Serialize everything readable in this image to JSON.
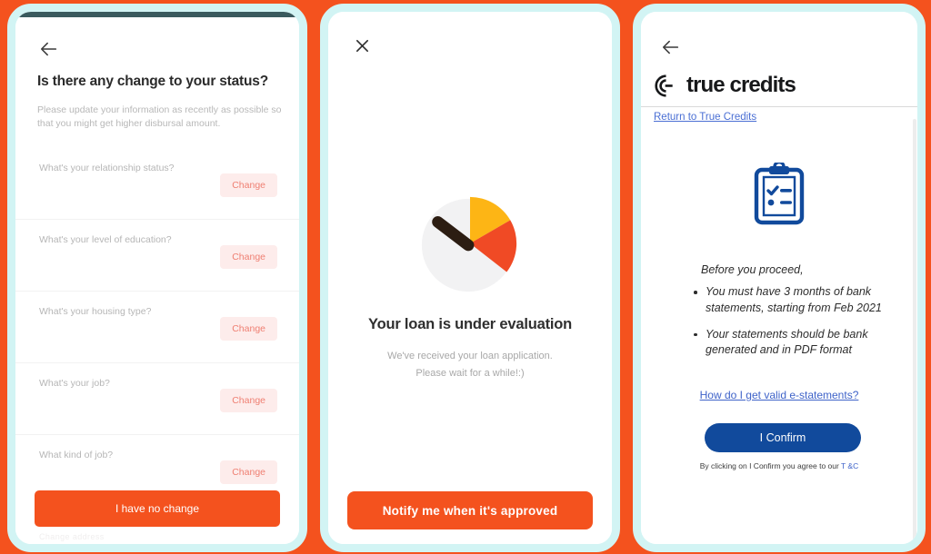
{
  "theme": {
    "background": "#f4521e",
    "panel_border": "#d2f4f4",
    "accent_orange": "#f4521e",
    "accent_blue": "#114a9c",
    "link_blue": "#3f63c9",
    "change_chip_bg": "#fdeceb",
    "change_chip_text": "#ef7f72",
    "muted_text": "#b6b6b6"
  },
  "panel1": {
    "name": "status-update-screen",
    "back_icon": "arrow-left-icon",
    "title": "Is there any change to your status?",
    "subtitle": "Please update your information as recently as possible so that you might get higher disbursal amount.",
    "rows": [
      {
        "label": "What's your relationship status?",
        "button": "Change"
      },
      {
        "label": "What's your level of education?",
        "button": "Change"
      },
      {
        "label": "What's your housing type?",
        "button": "Change"
      },
      {
        "label": "What's your job?",
        "button": "Change"
      },
      {
        "label": "What kind of job?",
        "button": "Change"
      }
    ],
    "cta": "I have no change",
    "cut_off_text": "Change address"
  },
  "panel2": {
    "name": "loan-evaluation-screen",
    "close_icon": "close-x-icon",
    "gauge_icon": "speedometer-gauge-icon",
    "gauge_colors": {
      "dial": "#f2f2f3",
      "yellow": "#fdb515",
      "orange": "#f04a25",
      "needle": "#2c1d12"
    },
    "title": "Your loan is under evaluation",
    "subtitle_line1": "We've received your loan application.",
    "subtitle_line2": "Please wait for a while!:)",
    "cta": "Notify me when it's approved"
  },
  "panel3": {
    "name": "true-credits-consent-screen",
    "back_icon": "arrow-left-icon",
    "brand_mark_icon": "true-credits-c-logo-icon",
    "brand_name": "true credits",
    "return_link": "Return to True Credits",
    "clipboard_icon": "clipboard-checklist-icon",
    "lead": "Before you proceed,",
    "bullets": [
      "You must have 3 months of bank statements, starting from Feb 2021",
      "Your statements should be bank generated and in PDF format"
    ],
    "help_link": "How do I get valid e-statements?",
    "confirm_button": "I Confirm",
    "fine_print_prefix": "By clicking on I Confirm you agree to our ",
    "fine_print_link": "T &C"
  }
}
